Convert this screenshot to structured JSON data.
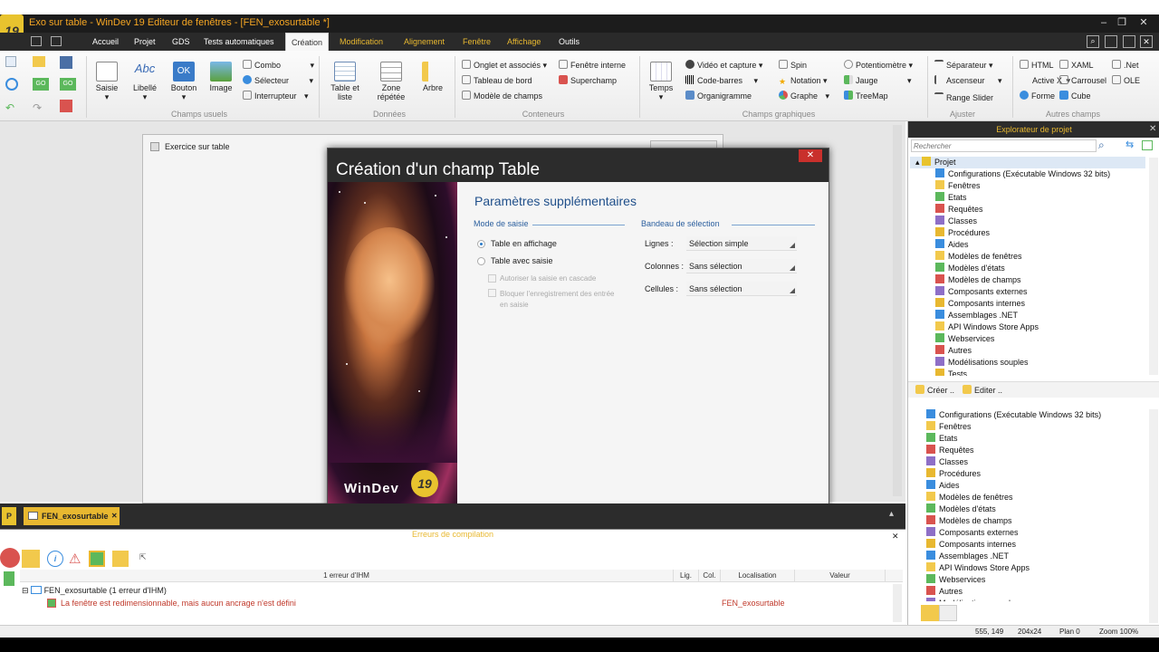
{
  "titlebar": {
    "title": "Exo sur table - WinDev 19  Editeur de fenêtres - [FEN_exosurtable *]",
    "logo": "19"
  },
  "menu": [
    "Accueil",
    "Projet",
    "GDS",
    "Tests automatiques",
    "Création",
    "Modification",
    "Alignement",
    "Fenêtre",
    "Affichage",
    "Outils"
  ],
  "ribbon": {
    "groups": [
      "Champs usuels",
      "Données",
      "Conteneurs",
      "Champs graphiques",
      "Ajuster",
      "Autres champs"
    ],
    "usuels": {
      "saisie": "Saisie",
      "libelle": "Libellé",
      "bouton": "Bouton",
      "image": "Image",
      "libelle_icon_text": "Abc",
      "bouton_icon_text": "OK",
      "combo": "Combo",
      "selecteur": "Sélecteur",
      "interrupteur": "Interrupteur"
    },
    "donnees": {
      "table": "Table et\nliste",
      "zone": "Zone\nrépétée",
      "arbre": "Arbre"
    },
    "conteneurs": {
      "onglet": "Onglet et associés",
      "tableau": "Tableau de bord",
      "modele": "Modèle de champs",
      "fenetre_interne": "Fenêtre interne",
      "superchamp": "Superchamp"
    },
    "graphiques": {
      "temps": "Temps",
      "video": "Vidéo et capture",
      "codebarres": "Code-barres",
      "organigramme": "Organigramme",
      "spin": "Spin",
      "notation": "Notation",
      "graphe": "Graphe",
      "potentiometre": "Potentiomètre",
      "jauge": "Jauge",
      "treemap": "TreeMap"
    },
    "ajuster": {
      "separateur": "Séparateur",
      "ascenseur": "Ascenseur",
      "rangeslider": "Range Slider"
    },
    "autres": {
      "html": "HTML",
      "activex": "Active X",
      "forme": "Forme",
      "xaml": "XAML",
      "carrousel": "Carrousel",
      "cube": "Cube",
      "net": ".Net",
      "ole": "OLE"
    }
  },
  "inner_window": {
    "title": "Exercice sur table"
  },
  "dialog": {
    "title": "Création d'un champ Table",
    "heading": "Paramètres supplémentaires",
    "mode_label": "Mode de saisie",
    "radio1": "Table en affichage",
    "radio2": "Table avec saisie",
    "chk1": "Autoriser la saisie en cascade",
    "chk2": "Bloquer l'enregistrement des entrée en saisie",
    "bandeau_label": "Bandeau de sélection",
    "lignes_label": "Lignes :",
    "lignes_value": "Sélection simple",
    "colonnes_label": "Colonnes :",
    "colonnes_value": "Sans sélection",
    "cellules_label": "Cellules :",
    "cellules_value": "Sans sélection",
    "brand": "WinDev",
    "brand_num": "19"
  },
  "explorer": {
    "title": "Explorateur de projet",
    "search_placeholder": "Rechercher",
    "root": "Projet",
    "items": [
      "Configurations (Exécutable Windows 32 bits)",
      "Fenêtres",
      "Etats",
      "Requêtes",
      "Classes",
      "Procédures",
      "Aides",
      "Modèles de fenêtres",
      "Modèles d'états",
      "Modèles de champs",
      "Composants externes",
      "Composants internes",
      "Assemblages .NET",
      "API Windows Store Apps",
      "Webservices",
      "Autres",
      "Modélisations souples",
      "Tests"
    ],
    "creer": "Créer ..",
    "editer": "Editer ..",
    "items2": [
      "Configurations (Exécutable Windows 32 bits)",
      "Fenêtres",
      "Etats",
      "Requêtes",
      "Classes",
      "Procédures",
      "Aides",
      "Modèles de fenêtres",
      "Modèles d'états",
      "Modèles de champs",
      "Composants externes",
      "Composants internes",
      "Assemblages .NET",
      "API Windows Store Apps",
      "Webservices",
      "Autres",
      "Modélisations souples"
    ]
  },
  "bottom": {
    "tab": "FEN_exosurtable",
    "panel_title": "Erreurs de compilation",
    "p_letter": "P"
  },
  "errors": {
    "headers": [
      "1 erreur d'IHM",
      "Lig.",
      "Col.",
      "Localisation",
      "Valeur"
    ],
    "group": "FEN_exosurtable (1 erreur d'IHM)",
    "message": "La fenêtre est redimensionnable, mais aucun ancrage n'est défini",
    "location": "FEN_exosurtable"
  },
  "status": {
    "coords": "555, 149",
    "size": "204x24",
    "plan": "Plan 0",
    "zoom": "Zoom 100%"
  }
}
